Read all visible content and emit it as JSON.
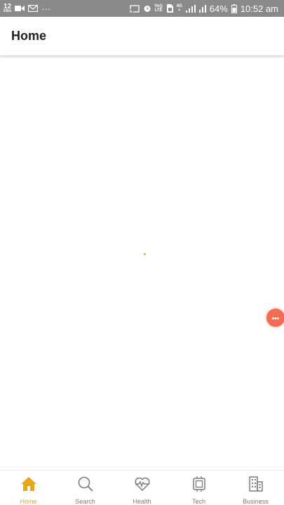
{
  "status_bar": {
    "speed_value": "12",
    "speed_unit": "KB/s",
    "more_dots": "···",
    "volte_top": "Vo))",
    "volte_bottom": "LTE",
    "network_type_top": "4G",
    "network_type_bottom": "+",
    "battery_percent": "64%",
    "time": "10:52 am"
  },
  "app_bar": {
    "title": "Home"
  },
  "colors": {
    "status_bar_bg": "#8a8a8a",
    "accent": "#e7a81b",
    "loading_dot": "#e2b600",
    "floating_bubble": "#f26b52",
    "inactive_icon": "#7a7a7a"
  },
  "bottom_nav": {
    "items": [
      {
        "label": "Home",
        "icon": "home-icon",
        "active": true
      },
      {
        "label": "Search",
        "icon": "search-icon",
        "active": false
      },
      {
        "label": "Health",
        "icon": "heart-pulse-icon",
        "active": false
      },
      {
        "label": "Tech",
        "icon": "chip-icon",
        "active": false
      },
      {
        "label": "Business",
        "icon": "building-icon",
        "active": false
      }
    ]
  }
}
